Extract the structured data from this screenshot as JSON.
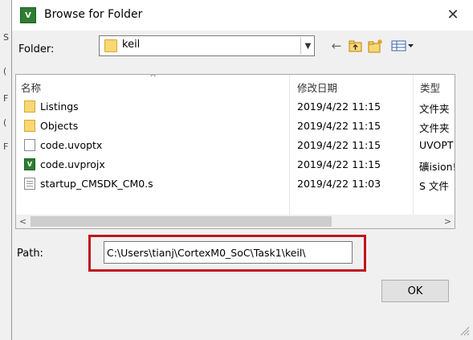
{
  "window": {
    "title": "Browse for Folder",
    "app_icon": "V",
    "close_glyph": "✕"
  },
  "folder": {
    "label": "Folder:",
    "value": "keil"
  },
  "toolbar": {
    "back_glyph": "←",
    "up_glyph": "⬆",
    "new_folder_glyph": "✱",
    "view_glyph": "▦▾"
  },
  "list": {
    "columns": {
      "name": "名称",
      "date": "修改日期",
      "type": "类型"
    },
    "sort_glyph": "^",
    "rows": [
      {
        "name": "Listings",
        "date": "2019/4/22 11:15",
        "type": "文件夹",
        "icon": "folder-icon"
      },
      {
        "name": "Objects",
        "date": "2019/4/22 11:15",
        "type": "文件夹",
        "icon": "folder-icon"
      },
      {
        "name": "code.uvoptx",
        "date": "2019/4/22 11:15",
        "type": "UVOPT",
        "icon": "file-icon"
      },
      {
        "name": "code.uvprojx",
        "date": "2019/4/22 11:15",
        "type": "礦ision!",
        "icon": "uvision-project-icon"
      },
      {
        "name": "startup_CMSDK_CM0.s",
        "date": "2019/4/22 11:03",
        "type": "S 文件",
        "icon": "text-file-icon"
      }
    ]
  },
  "scroll": {
    "left_glyph": "<",
    "right_glyph": ">"
  },
  "path": {
    "label": "Path:",
    "value": "C:\\Users\\tianj\\CortexM0_SoC\\Task1\\keil\\"
  },
  "buttons": {
    "ok": "OK"
  },
  "colors": {
    "highlight": "#c0151f",
    "folder": "#f8d775",
    "app": "#2e7d32"
  },
  "background": {
    "fragments": [
      "S",
      "(",
      "F",
      "(",
      "F"
    ]
  }
}
